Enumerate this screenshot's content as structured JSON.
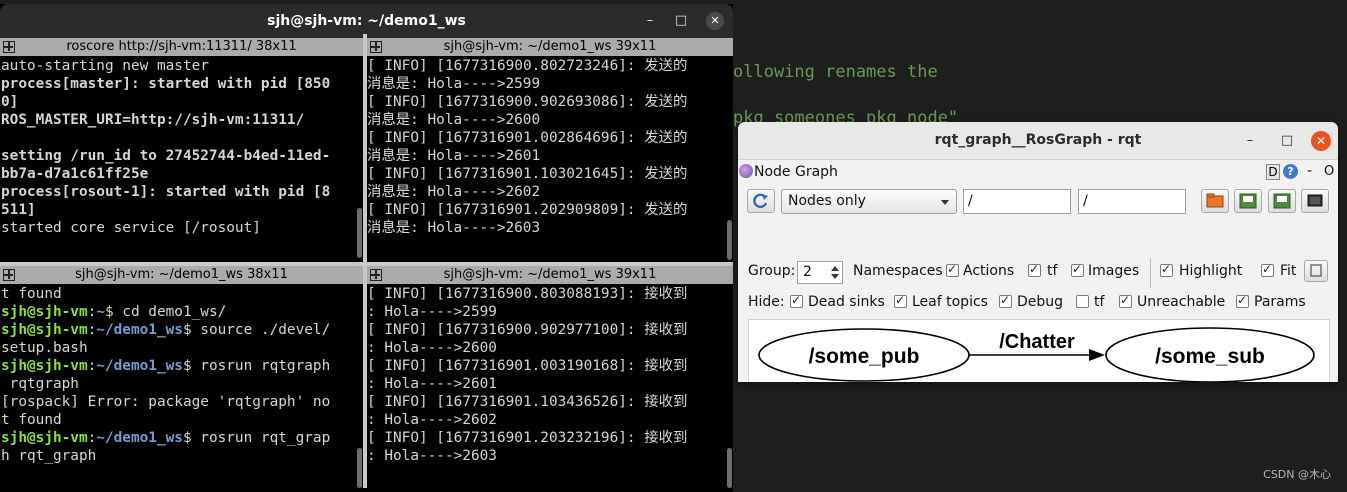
{
  "background_editor": {
    "lines": [
      "ollowing renames the",
      "pkg someones pkg node\""
    ],
    "watermark": "CSDN @木心"
  },
  "terminal_window": {
    "title": "sjh@sjh-vm: ~/demo1_ws",
    "controls": {
      "minimize": "–",
      "maximize": "□",
      "close": "✕"
    },
    "panes": [
      {
        "title": "roscore http://sjh-vm:11311/ 38x11",
        "lines": [
          {
            "text": "auto-starting new master",
            "bold": false
          },
          {
            "text": "process[master]: started with pid [850",
            "bold": true
          },
          {
            "text": "0]",
            "bold": true
          },
          {
            "text": "ROS_MASTER_URI=http://sjh-vm:11311/",
            "bold": true
          },
          {
            "text": "",
            "bold": false
          },
          {
            "text": "setting /run_id to 27452744-b4ed-11ed-",
            "bold": true
          },
          {
            "text": "bb7a-d7a1c61ff25e",
            "bold": true
          },
          {
            "text": "process[rosout-1]: started with pid [8",
            "bold": true
          },
          {
            "text": "511]",
            "bold": true
          },
          {
            "text": "started core service [/rosout]",
            "bold": false
          }
        ]
      },
      {
        "title": "sjh@sjh-vm: ~/demo1_ws 39x11",
        "lines": [
          "[ INFO] [1677316900.802723246]: 发送的",
          "消息是: Hola---->2599",
          "[ INFO] [1677316900.902693086]: 发送的",
          "消息是: Hola---->2600",
          "[ INFO] [1677316901.002864696]: 发送的",
          "消息是: Hola---->2601",
          "[ INFO] [1677316901.103021645]: 发送的",
          "消息是: Hola---->2602",
          "[ INFO] [1677316901.202909809]: 发送的",
          "消息是: Hola---->2603"
        ]
      },
      {
        "title": "sjh@sjh-vm: ~/demo1_ws 38x11",
        "prompt_user": "sjh@sjh-vm",
        "prompt_sep": ":",
        "lines": [
          {
            "type": "text",
            "text": "t found"
          },
          {
            "type": "prompt",
            "path": "~",
            "cmd": "$ cd demo1_ws/"
          },
          {
            "type": "prompt",
            "path": "~/demo1_ws",
            "cmd": "$ source ./devel/"
          },
          {
            "type": "text",
            "text": "setup.bash"
          },
          {
            "type": "prompt",
            "path": "~/demo1_ws",
            "cmd": "$ rosrun rqtgraph"
          },
          {
            "type": "text",
            "text": " rqtgraph"
          },
          {
            "type": "text",
            "text": "[rospack] Error: package 'rqtgraph' no"
          },
          {
            "type": "text",
            "text": "t found"
          },
          {
            "type": "prompt",
            "path": "~/demo1_ws",
            "cmd": "$ rosrun rqt_grap"
          },
          {
            "type": "text",
            "text": "h rqt_graph"
          }
        ]
      },
      {
        "title": "sjh@sjh-vm: ~/demo1_ws 39x11",
        "lines": [
          "[ INFO] [1677316900.803088193]: 接收到",
          ": Hola---->2599",
          "[ INFO] [1677316900.902977100]: 接收到",
          ": Hola---->2600",
          "[ INFO] [1677316901.003190168]: 接收到",
          ": Hola---->2601",
          "[ INFO] [1677316901.103436526]: 接收到",
          ": Hola---->2602",
          "[ INFO] [1677316901.203232196]: 接收到",
          ": Hola---->2603"
        ]
      }
    ]
  },
  "rqt_window": {
    "title": "rqt_graph__RosGraph - rqt",
    "controls": {
      "minimize": "–",
      "maximize": "□",
      "close": "✕"
    },
    "plugin": {
      "title": "Node Graph",
      "d_label": "D",
      "help_label": "?",
      "dash_label": "-",
      "o_label": "O"
    },
    "toolbar": {
      "mode_select": "Nodes only",
      "filter1": "/",
      "filter2": "/"
    },
    "group_row": {
      "group_label": "Group:",
      "group_value": "2",
      "checks": [
        {
          "label": "Namespaces",
          "checked": true
        },
        {
          "label": "Actions",
          "checked": true
        },
        {
          "label": "tf",
          "checked": true
        },
        {
          "label": "Images",
          "checked": true
        },
        {
          "label": "Highlight",
          "checked": true
        },
        {
          "label": "Fit",
          "checked": true
        }
      ]
    },
    "hide_row": {
      "hide_label": "Hide:",
      "checks": [
        {
          "label": "Dead sinks",
          "checked": true
        },
        {
          "label": "Leaf topics",
          "checked": true
        },
        {
          "label": "Debug",
          "checked": true
        },
        {
          "label": "tf",
          "checked": false
        },
        {
          "label": "Unreachable",
          "checked": true
        },
        {
          "label": "Params",
          "checked": true
        }
      ]
    },
    "graph": {
      "source_node": "/some_pub",
      "edge_label": "/Chatter",
      "target_node": "/some_sub"
    }
  }
}
